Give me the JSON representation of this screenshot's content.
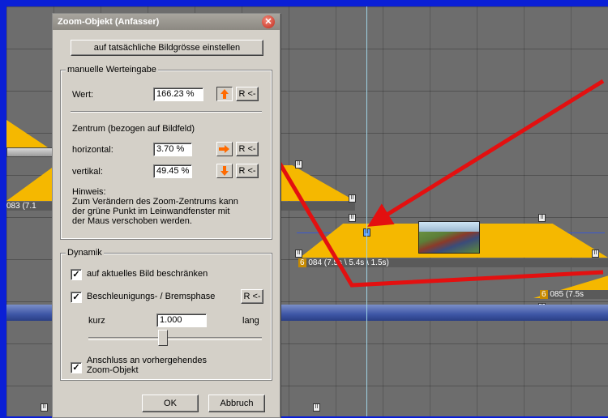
{
  "dialog": {
    "title": "Zoom-Objekt (Anfasser)",
    "actual_size_button": "auf tatsächliche Bildgrösse einstellen",
    "manual": {
      "legend": "manuelle Werteingabe",
      "wert_label": "Wert:",
      "wert_value": "166.23 %",
      "reset_label": "R <-",
      "center_heading": "Zentrum (bezogen auf Bildfeld)",
      "horizontal_label": "horizontal:",
      "horizontal_value": "3.70 %",
      "vertical_label": "vertikal:",
      "vertical_value": "49.45 %",
      "hint_title": "Hinweis:",
      "hint_line1": "Zum Verändern des Zoom-Zentrums kann",
      "hint_line2": "der grüne Punkt  im Leinwandfenster mit",
      "hint_line3": "der Maus verschoben werden."
    },
    "dynamik": {
      "legend": "Dynamik",
      "limit_label": "auf aktuelles Bild beschränken",
      "limit_checked": true,
      "accel_label": "Beschleunigungs- / Bremsphase",
      "accel_checked": true,
      "short_label": "kurz",
      "long_label": "lang",
      "speed_value": "1.000",
      "slider_level": 0.42,
      "attach_label_1": "Anschluss an vorhergehendes",
      "attach_label_2": "Zoom-Objekt",
      "attach_checked": true
    },
    "ok_label": "OK",
    "cancel_label": "Abbruch"
  },
  "timeline": {
    "clip_left_label": "083 (7.1",
    "clip_center_num": "6",
    "clip_center_label": "084 (7.5s \\ 5.4s \\ 1.5s)",
    "clip_right_num": "6",
    "clip_right_label": "085 (7.5s",
    "marker_glyph": "II"
  },
  "colors": {
    "annotation_arrow": "#e31010",
    "clip_fill": "#f5b800",
    "accent_orange": "#ff6a00"
  },
  "icons": [
    "close-icon",
    "arrow-up-icon",
    "arrow-right-icon",
    "arrow-down-icon",
    "reset-icon",
    "checkmark-icon"
  ]
}
